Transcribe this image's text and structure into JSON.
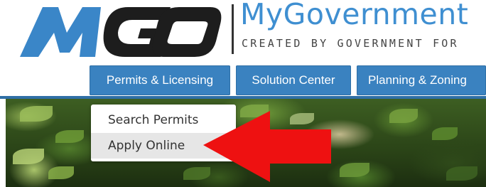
{
  "logo": {
    "mark_text": "MGO",
    "name": "MyGovernment",
    "tagline": "CREATED BY GOVERNMENT FOR",
    "mark_color": "#3a86c8",
    "dark_color": "#1d1d1d"
  },
  "nav": {
    "tabs": [
      {
        "label": "Permits & Licensing"
      },
      {
        "label": "Solution Center"
      },
      {
        "label": "Planning & Zoning"
      }
    ],
    "tab_color": "#3a82c0"
  },
  "dropdown": {
    "items": [
      {
        "label": "Search Permits"
      },
      {
        "label": "Apply Online"
      }
    ]
  },
  "annotation": {
    "arrow_color": "#ee1111",
    "arrow_icon": "arrow-left-icon"
  }
}
